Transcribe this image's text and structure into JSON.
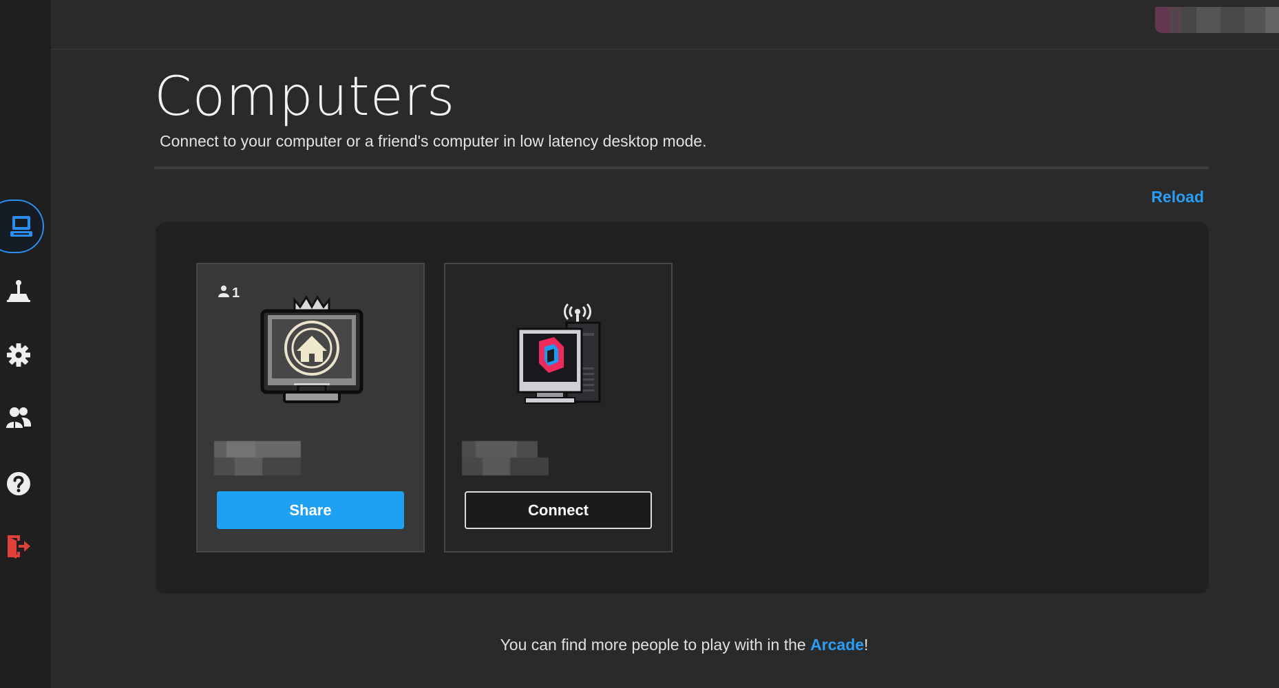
{
  "sidebar": {
    "items": [
      {
        "name": "computers",
        "icon": "computer-icon",
        "active": true
      },
      {
        "name": "arcade",
        "icon": "joystick-icon",
        "active": false
      },
      {
        "name": "settings",
        "icon": "gear-icon",
        "active": false
      },
      {
        "name": "friends",
        "icon": "users-icon",
        "active": false
      },
      {
        "name": "help",
        "icon": "help-icon",
        "active": false
      },
      {
        "name": "logout",
        "icon": "logout-icon",
        "active": false
      }
    ]
  },
  "header": {
    "title": "Computers",
    "subtitle": "Connect to your computer or a friend's computer in low latency desktop mode."
  },
  "actions": {
    "reload_label": "Reload"
  },
  "computers": [
    {
      "type": "local",
      "user_count": "1",
      "button_label": "Share",
      "icon": "home-monitor-icon"
    },
    {
      "type": "remote",
      "button_label": "Connect",
      "icon": "parsec-computer-icon"
    }
  ],
  "footer": {
    "prefix": "You can find more people to play with in the ",
    "link_label": "Arcade",
    "suffix": "!"
  },
  "colors": {
    "accent": "#1ea1f2",
    "background": "#2a2a2a",
    "panel": "#212121",
    "logout": "#e0403a"
  }
}
